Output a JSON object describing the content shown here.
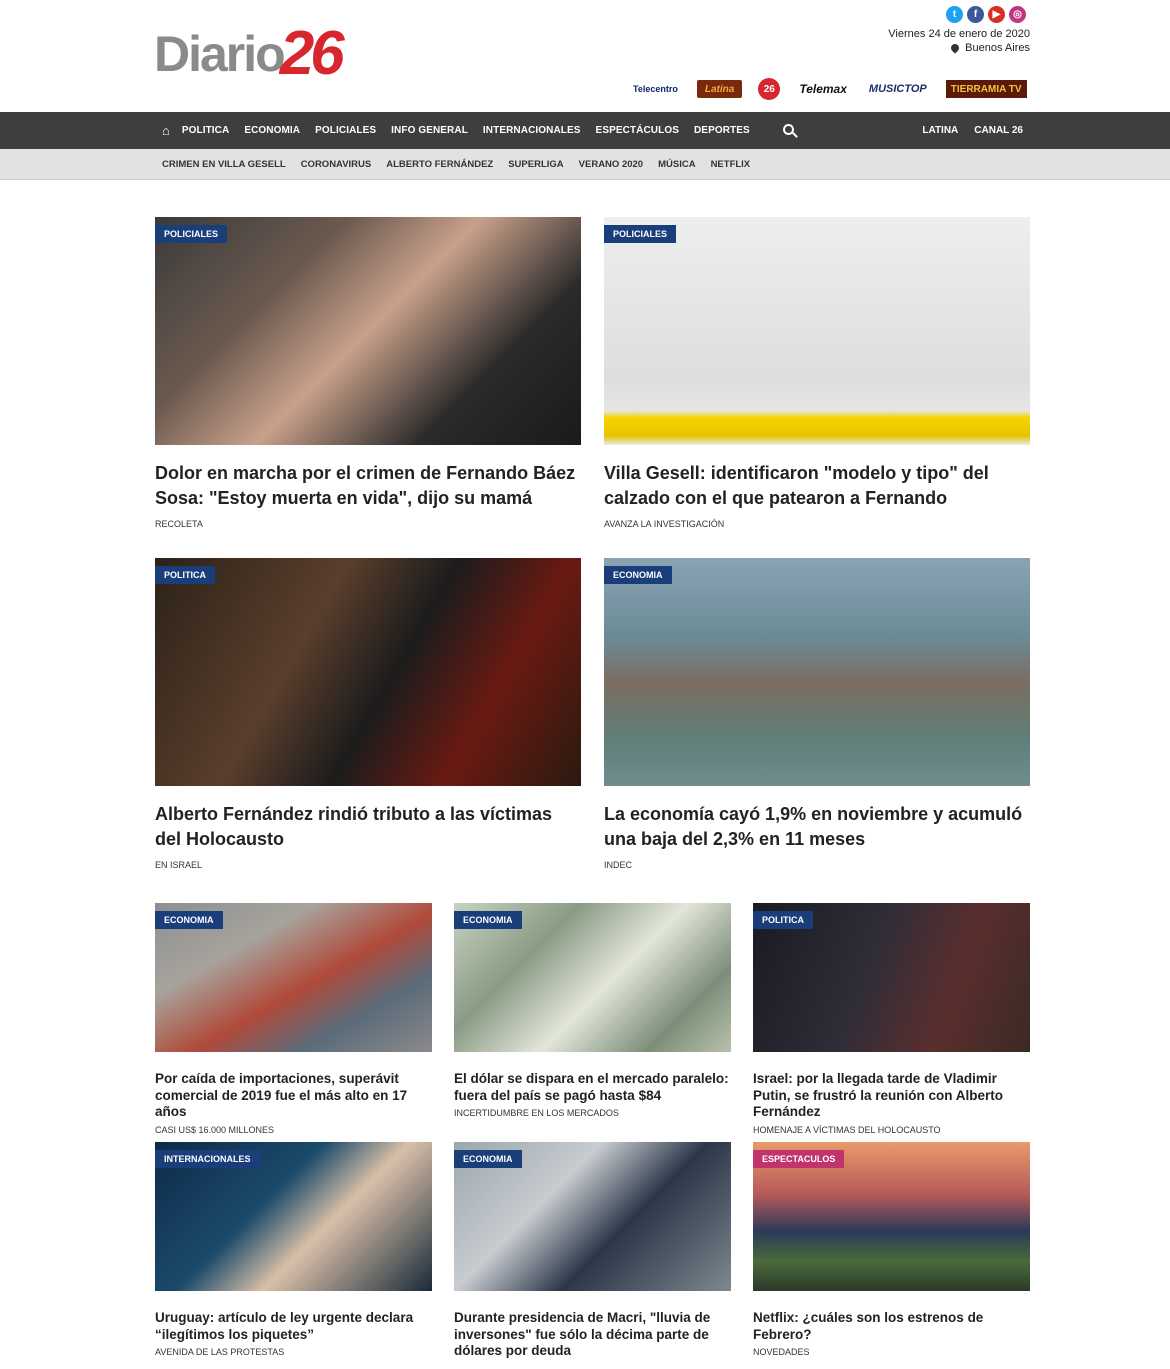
{
  "header": {
    "logo_text": "Diario",
    "logo_number": "26",
    "date": "Viernes 24 de enero de 2020",
    "city": "Buenos Aires",
    "socials": [
      {
        "name": "twitter-icon",
        "glyph": "t"
      },
      {
        "name": "facebook-icon",
        "glyph": "f"
      },
      {
        "name": "youtube-icon",
        "glyph": "▶"
      },
      {
        "name": "instagram-icon",
        "glyph": "◎"
      }
    ],
    "channels": [
      "Telecentro",
      "Latina",
      "26",
      "Telemax",
      "MUSICTOP",
      "TIERRAMIA TV"
    ]
  },
  "nav": {
    "home_glyph": "⌂",
    "items": [
      "POLITICA",
      "ECONOMIA",
      "POLICIALES",
      "INFO GENERAL",
      "INTERNACIONALES",
      "ESPECTÁCULOS",
      "DEPORTES"
    ],
    "right": [
      "LATINA",
      "CANAL 26"
    ]
  },
  "subnav": {
    "items": [
      "CRIMEN EN VILLA GESELL",
      "CORONAVIRUS",
      "ALBERTO FERNÁNDEZ",
      "SUPERLIGA",
      "VERANO 2020",
      "MÚSICA",
      "NETFLIX"
    ]
  },
  "articles": [
    {
      "tag": "POLICIALES",
      "title": "Dolor en marcha por el crimen de Fernando Báez Sosa: \"Estoy muerta en vida\", dijo su mamá",
      "kicker": "RECOLETA"
    },
    {
      "tag": "POLICIALES",
      "title": "Villa Gesell: identificaron \"modelo y tipo\" del calzado con el que patearon a Fernando",
      "kicker": "AVANZA LA INVESTIGACIÓN"
    },
    {
      "tag": "POLITICA",
      "title": "Alberto Fernández rindió tributo a las víctimas del Holocausto",
      "kicker": "EN ISRAEL"
    },
    {
      "tag": "ECONOMIA",
      "title": "La economía cayó 1,9% en noviembre y acumuló una baja del 2,3% en 11 meses",
      "kicker": "INDEC"
    },
    {
      "tag": "ECONOMIA",
      "title": "Por caída de importaciones, superávit comercial de 2019 fue el más alto en 17 años",
      "kicker": "CASI US$ 16.000 MILLONES"
    },
    {
      "tag": "ECONOMIA",
      "title": "El dólar se dispara en el mercado paralelo: fuera del país se pagó hasta $84",
      "kicker": "INCERTIDUMBRE EN LOS MERCADOS"
    },
    {
      "tag": "POLITICA",
      "title": "Israel: por la llegada tarde de Vladimir Putin, se frustró la reunión con Alberto Fernández",
      "kicker": "HOMENAJE A VÍCTIMAS DEL HOLOCAUSTO"
    },
    {
      "tag": "INTERNACIONALES",
      "title": "Uruguay: artículo de ley urgente declara “ilegítimos los piquetes”",
      "kicker": "AVENIDA DE LAS PROTESTAS"
    },
    {
      "tag": "ECONOMIA",
      "title": "Durante presidencia de Macri, \"lluvia de inversones\" fue sólo la décima parte de dólares por deuda",
      "kicker": ""
    },
    {
      "tag": "ESPECTACULOS",
      "title": "Netflix: ¿cuáles son los estrenos de Febrero?",
      "kicker": "NOVEDADES"
    }
  ]
}
